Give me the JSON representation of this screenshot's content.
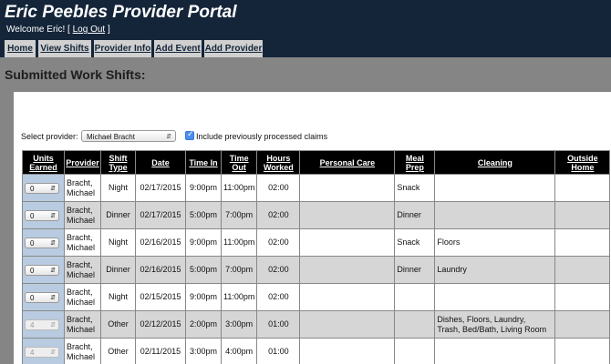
{
  "header": {
    "title": "Eric Peebles Provider Portal",
    "welcome_text": "Welcome Eric! [ ",
    "logout_label": "Log Out",
    "welcome_close": " ]"
  },
  "nav": {
    "items": [
      {
        "label": "Home"
      },
      {
        "label": "View Shifts"
      },
      {
        "label": "Provider Info"
      },
      {
        "label": "Add Event"
      },
      {
        "label": "Add Provider"
      }
    ]
  },
  "page": {
    "heading": "Submitted Work Shifts:"
  },
  "filter": {
    "provider_label": "Select provider:",
    "provider_selected": "Michael Bracht",
    "include_label": "Include previously processed claims",
    "include_checked": true
  },
  "table": {
    "headers": [
      {
        "line1": "Units",
        "line2": "Earned"
      },
      {
        "line1": "Provider",
        "line2": ""
      },
      {
        "line1": "Shift",
        "line2": "Type"
      },
      {
        "line1": "Date",
        "line2": ""
      },
      {
        "line1": "Time In",
        "line2": ""
      },
      {
        "line1": "Time",
        "line2": "Out"
      },
      {
        "line1": "Hours",
        "line2": "Worked"
      },
      {
        "line1": "Personal Care",
        "line2": ""
      },
      {
        "line1": "Meal",
        "line2": "Prep"
      },
      {
        "line1": "Cleaning",
        "line2": ""
      },
      {
        "line1": "Outside",
        "line2": "Home"
      }
    ],
    "rows": [
      {
        "units": "0",
        "units_disabled": false,
        "provider_line1": "Bracht,",
        "provider_line2": "Michael",
        "shift_type": "Night",
        "date": "02/17/2015",
        "time_in": "9:00pm",
        "time_out": "11:00pm",
        "hours": "02:00",
        "personal_care": "",
        "meal_prep": "Snack",
        "cleaning_line1": "",
        "cleaning_line2": "",
        "outside_home": ""
      },
      {
        "units": "0",
        "units_disabled": false,
        "provider_line1": "Bracht,",
        "provider_line2": "Michael",
        "shift_type": "Dinner",
        "date": "02/17/2015",
        "time_in": "5:00pm",
        "time_out": "7:00pm",
        "hours": "02:00",
        "personal_care": "",
        "meal_prep": "Dinner",
        "cleaning_line1": "",
        "cleaning_line2": "",
        "outside_home": ""
      },
      {
        "units": "0",
        "units_disabled": false,
        "provider_line1": "Bracht,",
        "provider_line2": "Michael",
        "shift_type": "Night",
        "date": "02/16/2015",
        "time_in": "9:00pm",
        "time_out": "11:00pm",
        "hours": "02:00",
        "personal_care": "",
        "meal_prep": "Snack",
        "cleaning_line1": "Floors",
        "cleaning_line2": "",
        "outside_home": ""
      },
      {
        "units": "0",
        "units_disabled": false,
        "provider_line1": "Bracht,",
        "provider_line2": "Michael",
        "shift_type": "Dinner",
        "date": "02/16/2015",
        "time_in": "5:00pm",
        "time_out": "7:00pm",
        "hours": "02:00",
        "personal_care": "",
        "meal_prep": "Dinner",
        "cleaning_line1": "Laundry",
        "cleaning_line2": "",
        "outside_home": ""
      },
      {
        "units": "0",
        "units_disabled": false,
        "provider_line1": "Bracht,",
        "provider_line2": "Michael",
        "shift_type": "Night",
        "date": "02/15/2015",
        "time_in": "9:00pm",
        "time_out": "11:00pm",
        "hours": "02:00",
        "personal_care": "",
        "meal_prep": "",
        "cleaning_line1": "",
        "cleaning_line2": "",
        "outside_home": ""
      },
      {
        "units": "4",
        "units_disabled": true,
        "provider_line1": "Bracht,",
        "provider_line2": "Michael",
        "shift_type": "Other",
        "date": "02/12/2015",
        "time_in": "2:00pm",
        "time_out": "3:00pm",
        "hours": "01:00",
        "personal_care": "",
        "meal_prep": "",
        "cleaning_line1": "Dishes, Floors, Laundry,",
        "cleaning_line2": "Trash, Bed/Bath, Living Room",
        "outside_home": ""
      },
      {
        "units": "4",
        "units_disabled": true,
        "provider_line1": "Bracht,",
        "provider_line2": "Michael",
        "shift_type": "Other",
        "date": "02/11/2015",
        "time_in": "3:00pm",
        "time_out": "4:00pm",
        "hours": "01:00",
        "personal_care": "",
        "meal_prep": "",
        "cleaning_line1": "",
        "cleaning_line2": "",
        "outside_home": ""
      }
    ]
  },
  "colors": {
    "header_bg": "#14253a",
    "page_bg": "#858585",
    "table_header_bg": "#000000",
    "row_alt_bg": "#d6d6d6",
    "units_cell_bg": "#b8cbe0"
  }
}
